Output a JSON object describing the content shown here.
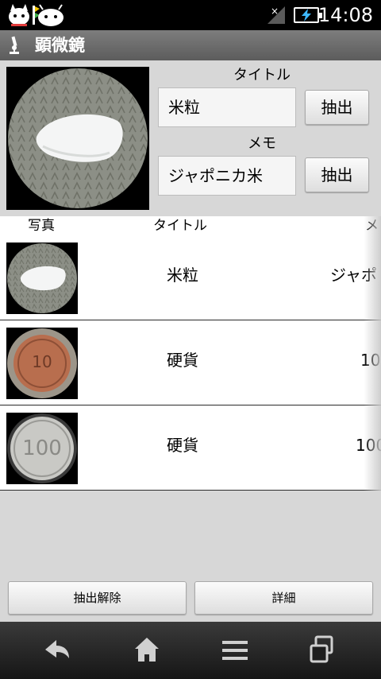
{
  "status_bar": {
    "time": "14:08"
  },
  "app": {
    "title": "顕微鏡"
  },
  "editor": {
    "title_label": "タイトル",
    "title_value": "米粒",
    "memo_label": "メモ",
    "memo_value": "ジャポニカ米",
    "extract_label": "抽出"
  },
  "list": {
    "headers": {
      "photo": "写真",
      "title": "タイトル",
      "memo": "メ"
    },
    "rows": [
      {
        "title": "米粒",
        "memo": "ジャポ",
        "image": "rice-grain-icon"
      },
      {
        "title": "硬貨",
        "memo": "10",
        "image": "coin-10-yen-icon"
      },
      {
        "title": "硬貨",
        "memo": "100",
        "image": "coin-100-yen-icon"
      }
    ]
  },
  "actions": {
    "clear_extract": "抽出解除",
    "details": "詳細"
  },
  "colors": {
    "titlebar": "#6b6b6b",
    "background": "#d7d7d7",
    "status_bar": "#000000"
  }
}
